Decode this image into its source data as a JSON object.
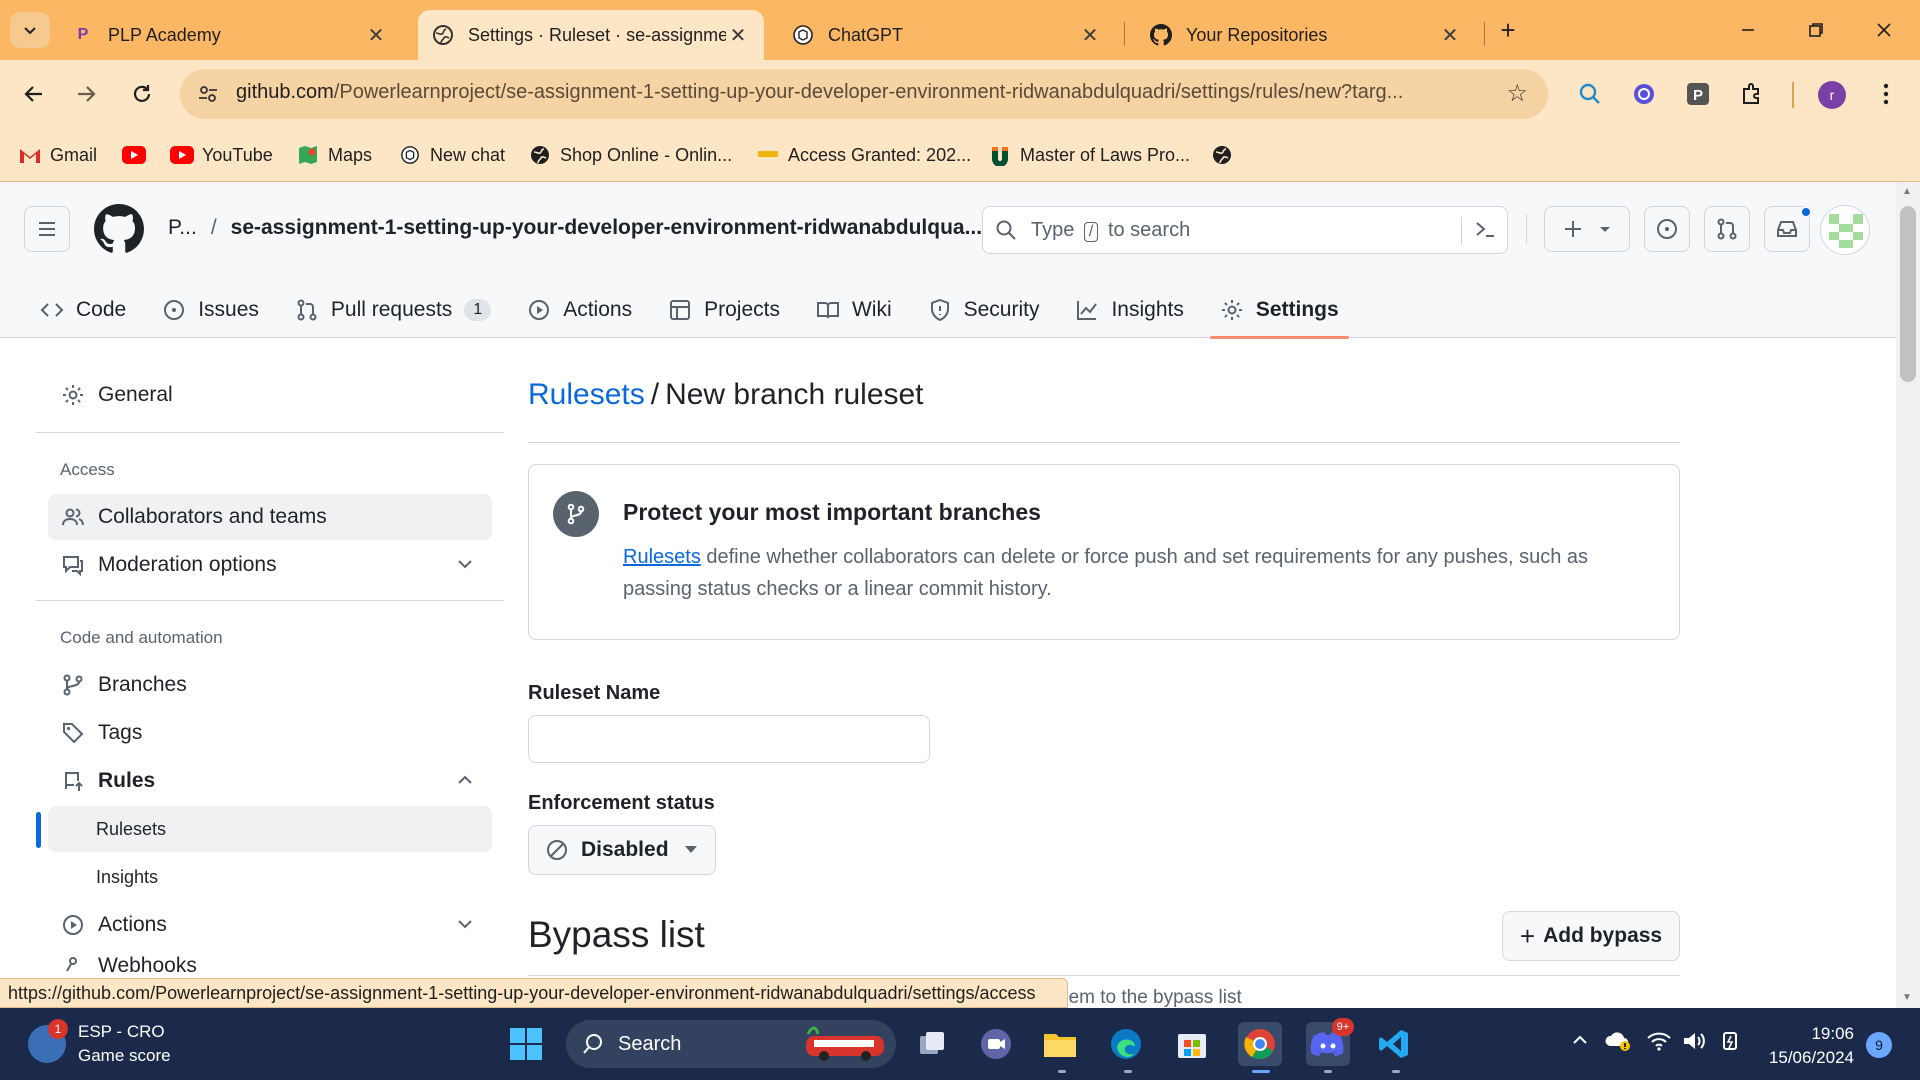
{
  "browser": {
    "tabs": [
      {
        "title": "PLP Academy",
        "icon": "plp-icon"
      },
      {
        "title": "Settings · Ruleset · se-assignme",
        "icon": "github-settings-icon"
      },
      {
        "title": "ChatGPT",
        "icon": "chatgpt-icon"
      },
      {
        "title": "Your Repositories",
        "icon": "github-icon"
      }
    ],
    "url_host": "github.com",
    "url_path": "/Powerlearnproject/se-assignment-1-setting-up-your-developer-environment-ridwanabdulquadri/settings/rules/new?targ...",
    "profile_initial": "r",
    "bookmarks": [
      {
        "label": "Gmail",
        "icon": "gmail-icon"
      },
      {
        "label": "",
        "icon": "youtube-icon"
      },
      {
        "label": "YouTube",
        "icon": "youtube-icon"
      },
      {
        "label": "Maps",
        "icon": "maps-icon"
      },
      {
        "label": "New chat",
        "icon": "chatgpt-icon"
      },
      {
        "label": "Shop Online - Onlin...",
        "icon": "globe-icon"
      },
      {
        "label": "Access Granted: 202...",
        "icon": "folder-icon"
      },
      {
        "label": "Master of Laws Pro...",
        "icon": "university-icon"
      },
      {
        "label": "",
        "icon": "globe-icon"
      }
    ],
    "status_url": "https://github.com/Powerlearnproject/se-assignment-1-setting-up-your-developer-environment-ridwanabdulquadri/settings/access"
  },
  "github": {
    "owner_short": "P...",
    "repo": "se-assignment-1-setting-up-your-developer-environment-ridwanabdulqua...",
    "search_type": "Type",
    "search_slash": "/",
    "search_rest": "to search",
    "repo_nav": [
      {
        "label": "Code",
        "icon": "code-icon"
      },
      {
        "label": "Issues",
        "icon": "issue-icon"
      },
      {
        "label": "Pull requests",
        "icon": "pull-request-icon",
        "count": "1"
      },
      {
        "label": "Actions",
        "icon": "play-icon"
      },
      {
        "label": "Projects",
        "icon": "table-icon"
      },
      {
        "label": "Wiki",
        "icon": "book-icon"
      },
      {
        "label": "Security",
        "icon": "shield-icon"
      },
      {
        "label": "Insights",
        "icon": "graph-icon"
      },
      {
        "label": "Settings",
        "icon": "gear-icon"
      }
    ]
  },
  "sidebar": {
    "general": "General",
    "access_heading": "Access",
    "collaborators": "Collaborators and teams",
    "moderation": "Moderation options",
    "code_heading": "Code and automation",
    "branches": "Branches",
    "tags": "Tags",
    "rules": "Rules",
    "rulesets": "Rulesets",
    "insights": "Insights",
    "actions": "Actions",
    "webhooks": "Webhooks"
  },
  "main": {
    "breadcrumb_link": "Rulesets",
    "breadcrumb_sep": "/",
    "title": "New branch ruleset",
    "info_title": "Protect your most important branches",
    "info_link": "Rulesets",
    "info_text": " define whether collaborators can delete or force push and set requirements for any pushes, such as passing status checks or a linear commit history.",
    "name_label": "Ruleset Name",
    "name_value": "",
    "enforcement_label": "Enforcement status",
    "enforcement_value": "Disabled",
    "bypass_title": "Bypass list",
    "add_bypass": "Add bypass",
    "bypass_note": "hem to the bypass list"
  },
  "taskbar": {
    "news_badge": "1",
    "news_line1": "ESP - CRO",
    "news_line2": "Game score",
    "search_label": "Search",
    "time": "19:06",
    "date": "15/06/2024",
    "notification_count": "9",
    "discord_badge": "9+"
  }
}
